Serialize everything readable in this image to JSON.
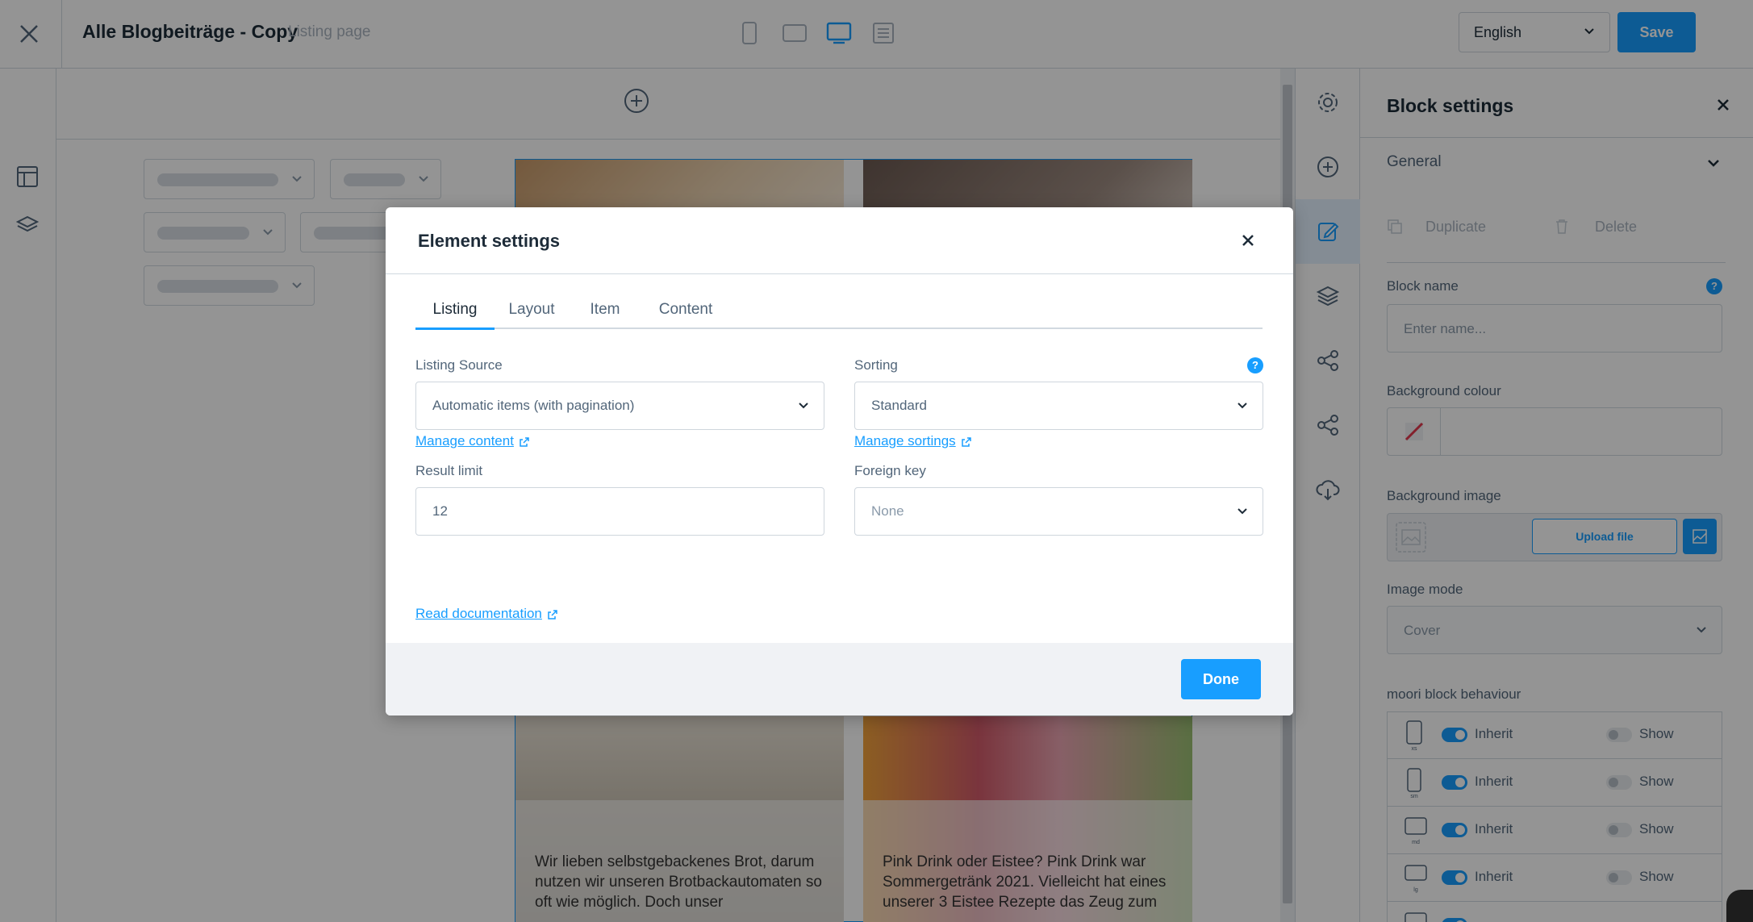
{
  "header": {
    "page_title": "Alle Blogbeiträge - Copy",
    "page_type": "Listing page",
    "language": "English",
    "save_label": "Save"
  },
  "cards": [
    "Wir lieben selbstgebackenes Brot, darum nutzen wir unseren Brotbackautomaten so oft wie möglich. Doch unser",
    "Pink Drink oder Eistee? Pink Drink war Sommergetränk 2021. Vielleicht hat eines unserer 3 Eistee Rezepte das Zeug zum"
  ],
  "settings_panel": {
    "title": "Block settings",
    "general_label": "General",
    "duplicate_label": "Duplicate",
    "delete_label": "Delete",
    "block_name_label": "Block name",
    "block_name_placeholder": "Enter name...",
    "bg_colour_label": "Background colour",
    "bg_image_label": "Background image",
    "upload_label": "Upload file",
    "image_mode_label": "Image mode",
    "image_mode_value": "Cover",
    "behaviour_label": "moori block behaviour",
    "behaviour_rows": [
      {
        "device": "xs",
        "inherit": "Inherit",
        "show": "Show"
      },
      {
        "device": "sm",
        "inherit": "Inherit",
        "show": "Show"
      },
      {
        "device": "md",
        "inherit": "Inherit",
        "show": "Show"
      },
      {
        "device": "lg",
        "inherit": "Inherit",
        "show": "Show"
      }
    ]
  },
  "modal": {
    "title": "Element settings",
    "tabs": [
      "Listing",
      "Layout",
      "Item",
      "Content"
    ],
    "listing_source_label": "Listing Source",
    "listing_source_value": "Automatic items (with pagination)",
    "manage_content": "Manage content",
    "sorting_label": "Sorting",
    "sorting_value": "Standard",
    "manage_sortings": "Manage sortings",
    "result_limit_label": "Result limit",
    "result_limit_value": "12",
    "foreign_key_label": "Foreign key",
    "foreign_key_value": "None",
    "read_docs": "Read documentation",
    "done_label": "Done"
  },
  "colors": {
    "accent": "#189eff",
    "text_dark": "#1d2b38",
    "text_muted": "#52667a"
  }
}
